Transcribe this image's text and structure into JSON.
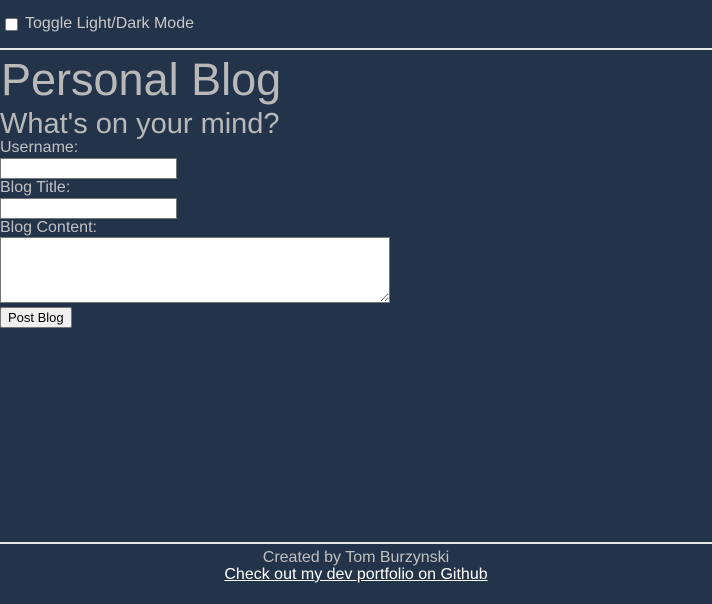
{
  "header": {
    "toggle_label": "Toggle Light/Dark Mode",
    "toggle_checked": false
  },
  "main": {
    "title": "Personal Blog",
    "subtitle": "What's on your mind?",
    "form": {
      "username_label": "Username:",
      "username_value": "",
      "title_label": "Blog Title:",
      "title_value": "",
      "content_label": "Blog Content:",
      "content_value": "",
      "submit_label": "Post Blog"
    }
  },
  "footer": {
    "credit": "Created by Tom Burzynski",
    "link_text": "Check out my dev portfolio on Github"
  },
  "colors": {
    "background": "#22334a",
    "text": "#c0c0c0",
    "divider": "#e6e6e6",
    "link": "#ffffff"
  }
}
